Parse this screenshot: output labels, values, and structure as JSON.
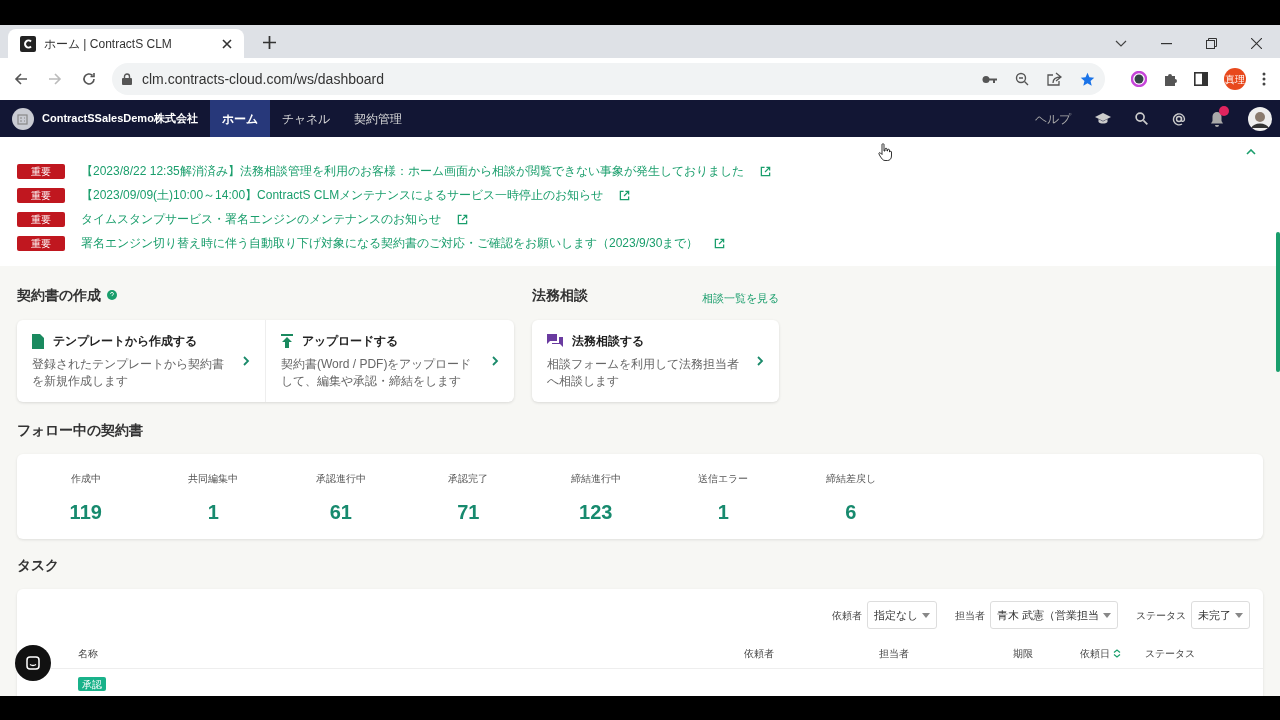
{
  "browser": {
    "tab_title": "ホーム | ContractS CLM",
    "url": "clm.contracts-cloud.com/ws/dashboard",
    "profile": "真理"
  },
  "app_nav": {
    "company": "ContractSSalesDemo株式会社",
    "items": [
      {
        "label": "ホーム",
        "selected": true
      },
      {
        "label": "チャネル",
        "selected": false
      },
      {
        "label": "契約管理",
        "selected": false
      }
    ],
    "help": "ヘルプ",
    "notification": true
  },
  "notices": [
    {
      "badge": "重要",
      "text": "【2023/8/22 12:35解消済み】法務相談管理を利用のお客様：ホーム画面から相談が閲覧できない事象が発生しておりました"
    },
    {
      "badge": "重要",
      "text": "【2023/09/09(土)10:00～14:00】ContractS CLMメンテナンスによるサービス一時停止のお知らせ"
    },
    {
      "badge": "重要",
      "text": "タイムスタンプサービス・署名エンジンのメンテナンスのお知らせ"
    },
    {
      "badge": "重要",
      "text": "署名エンジン切り替え時に伴う自動取り下げ対象になる契約書のご対応・ご確認をお願いします（2023/9/30まで）"
    }
  ],
  "create": {
    "title": "契約書の作成",
    "cards": [
      {
        "kind": "template",
        "title": "テンプレートから作成する",
        "desc": "登録されたテンプレートから契約書を新規作成します"
      },
      {
        "kind": "upload",
        "title": "アップロードする",
        "desc": "契約書(Word / PDF)をアップロードして、編集や承認・締結をします"
      }
    ]
  },
  "legal": {
    "title": "法務相談",
    "link": "相談一覧を見る",
    "card": {
      "title": "法務相談する",
      "desc": "相談フォームを利用して法務担当者へ相談します"
    }
  },
  "following": {
    "title": "フォロー中の契約書",
    "stats": [
      {
        "label": "作成中",
        "value": "119"
      },
      {
        "label": "共同編集中",
        "value": "1"
      },
      {
        "label": "承認進行中",
        "value": "61"
      },
      {
        "label": "承認完了",
        "value": "71"
      },
      {
        "label": "締結進行中",
        "value": "123"
      },
      {
        "label": "送信エラー",
        "value": "1"
      },
      {
        "label": "締結差戻し",
        "value": "6"
      }
    ]
  },
  "tasks": {
    "title": "タスク",
    "filters": [
      {
        "label": "依頼者",
        "value": "指定なし"
      },
      {
        "label": "担当者",
        "value": "青木 武憲（営業担当"
      },
      {
        "label": "ステータス",
        "value": "未完了"
      }
    ],
    "columns": [
      "名称",
      "依頼者",
      "担当者",
      "期限",
      "依頼日",
      "ステータス"
    ],
    "rows": [
      {
        "badge": "承認"
      }
    ]
  }
}
